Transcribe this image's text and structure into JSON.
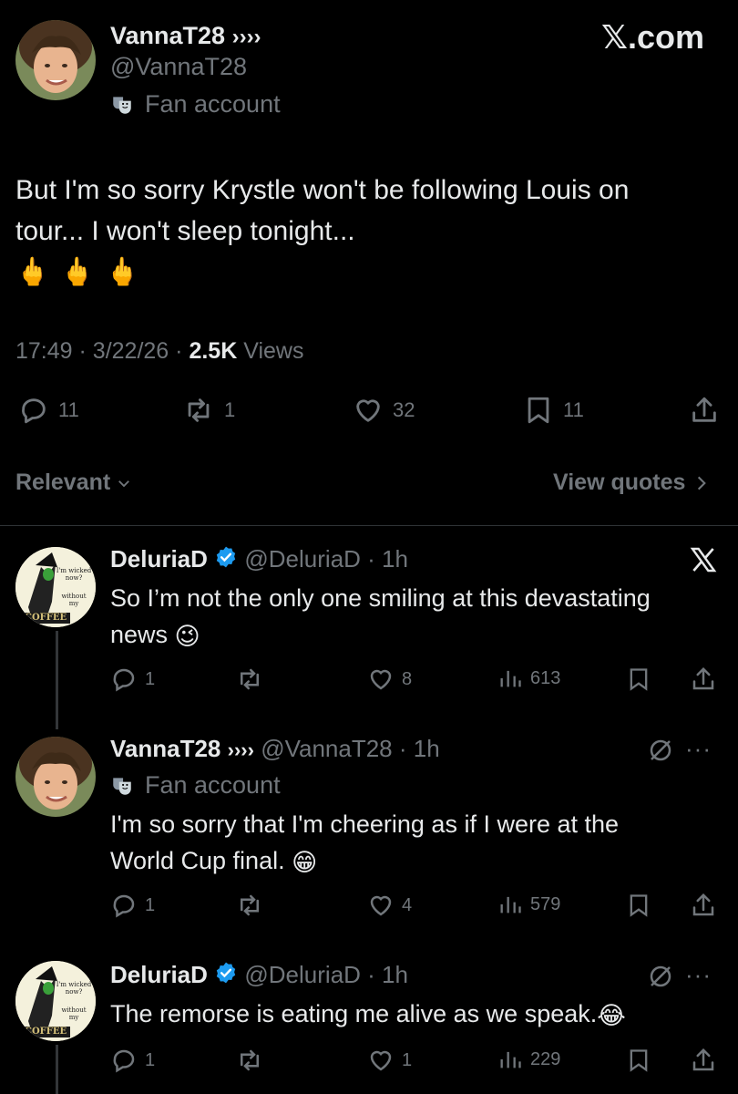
{
  "header": {
    "site": "𝕏.com"
  },
  "main_post": {
    "display_name": "VannaT28",
    "name_suffix": "››››",
    "handle": "@VannaT28",
    "badge_label": "Fan account",
    "text_line1": "But I'm so sorry Krystle won't be following Louis on",
    "text_line2": "tour... I won't sleep tonight...",
    "emojis": "🖕🖕🖕",
    "time": "17:49",
    "date": "3/22/26",
    "views_count": "2.5K",
    "views_label": "Views",
    "stats": {
      "replies": "11",
      "reposts": "1",
      "likes": "32",
      "bookmarks": "11"
    }
  },
  "filter_bar": {
    "sort_label": "Relevant",
    "quotes_label": "View quotes"
  },
  "replies": [
    {
      "display_name": "DeluriaD",
      "handle": "@DeluriaD",
      "time": "1h",
      "line1": "So I’m not the only one smiling at this devastating",
      "line2": "news",
      "emoji": "😉",
      "stats": {
        "replies": "1",
        "reposts": "",
        "likes": "8",
        "views": "613"
      }
    },
    {
      "display_name": "VannaT28",
      "name_suffix": "››››",
      "handle": "@VannaT28",
      "time": "1h",
      "badge_label": "Fan account",
      "line1": "I'm so sorry that I'm cheering as if I were at the",
      "line2": "World Cup final.",
      "emoji": "😁",
      "stats": {
        "replies": "1",
        "reposts": "",
        "likes": "4",
        "views": "579"
      }
    },
    {
      "display_name": "DeluriaD",
      "handle": "@DeluriaD",
      "time": "1h",
      "line1": "The remorse is eating me alive as we speak.",
      "emoji": "😂",
      "stats": {
        "replies": "1",
        "reposts": "",
        "likes": "1",
        "views": "229"
      }
    }
  ],
  "avatar_text": {
    "line1": "I'm wicked",
    "line2": "now?",
    "line3": "without",
    "line4": "my",
    "line5": "COFFEE"
  },
  "colors": {
    "background": "#000000",
    "text": "#e7e9ea",
    "muted": "#71767b",
    "verified": "#1d9bf0",
    "divider": "#2f3336"
  }
}
